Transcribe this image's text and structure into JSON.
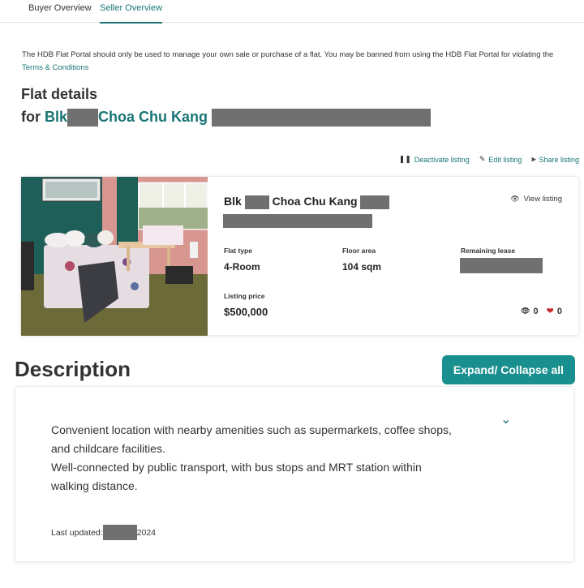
{
  "tabs": [
    {
      "label": "Buyer Overview",
      "active": false
    },
    {
      "label": "Seller Overview",
      "active": true
    }
  ],
  "notice": {
    "text": "The HDB Flat Portal should only be used to manage your own sale or purchase of a flat. You may be banned from using the HDB Flat Portal for violating the",
    "link": "Terms & Conditions"
  },
  "heading": {
    "title": "Flat details",
    "for_prefix": "for",
    "blk": "Blk",
    "town": "Choa Chu Kang"
  },
  "actions": {
    "deactivate": "Deactivate listing",
    "edit": "Edit listing",
    "share": "Share listing"
  },
  "listing": {
    "blk": "Blk",
    "town": "Choa Chu Kang",
    "view_listing": "View listing",
    "flat_type_label": "Flat type",
    "flat_type": "4-Room",
    "floor_area_label": "Floor area",
    "floor_area": "104 sqm",
    "remaining_lease_label": "Remaining lease",
    "price_label": "Listing price",
    "price": "$500,000",
    "views": "0",
    "likes": "0"
  },
  "description": {
    "title": "Description",
    "expand_button": "Expand/ Collapse all",
    "paragraph1": "Convenient location with nearby amenities such as supermarkets, coffee shops, and childcare facilities.",
    "paragraph2": "Well-connected by public transport, with bus stops and MRT station within walking distance.",
    "last_updated_label": "Last updated:",
    "last_updated_year": "2024"
  },
  "colors": {
    "accent": "#1a7575",
    "button": "#1a8f8f",
    "redaction": "#707070",
    "heart": "#c62828"
  }
}
